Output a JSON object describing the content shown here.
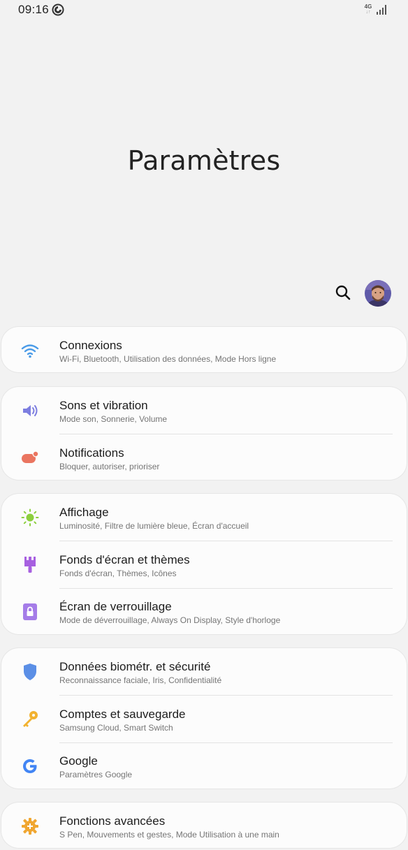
{
  "status_bar": {
    "time": "09:16",
    "network": "4G"
  },
  "header": {
    "title": "Paramètres"
  },
  "colors": {
    "wifi": "#4a9be8",
    "sound": "#7d7ee0",
    "notifications": "#ea7560",
    "display": "#8ccf3e",
    "wallpaper": "#a760e0",
    "lock": "#a57ce8",
    "biometrics": "#5b8fe6",
    "accounts": "#f2b230",
    "google": "#4285f4",
    "advanced": "#f0a630"
  },
  "groups": [
    {
      "items": [
        {
          "icon": "wifi-icon",
          "title": "Connexions",
          "subtitle": "Wi-Fi, Bluetooth, Utilisation des données, Mode Hors ligne"
        }
      ]
    },
    {
      "items": [
        {
          "icon": "speaker-icon",
          "title": "Sons et vibration",
          "subtitle": "Mode son, Sonnerie, Volume"
        },
        {
          "icon": "notification-icon",
          "title": "Notifications",
          "subtitle": "Bloquer, autoriser, prioriser"
        }
      ]
    },
    {
      "items": [
        {
          "icon": "brightness-icon",
          "title": "Affichage",
          "subtitle": "Luminosité, Filtre de lumière bleue, Écran d'accueil"
        },
        {
          "icon": "paintbrush-icon",
          "title": "Fonds d'écran et thèmes",
          "subtitle": "Fonds d'écran, Thèmes, Icônes"
        },
        {
          "icon": "lock-icon",
          "title": "Écran de verrouillage",
          "subtitle": "Mode de déverrouillage, Always On Display, Style d'horloge"
        }
      ]
    },
    {
      "items": [
        {
          "icon": "shield-icon",
          "title": "Données biométr. et sécurité",
          "subtitle": "Reconnaissance faciale, Iris, Confidentialité"
        },
        {
          "icon": "key-icon",
          "title": "Comptes et sauvegarde",
          "subtitle": "Samsung Cloud, Smart Switch"
        },
        {
          "icon": "google-icon",
          "title": "Google",
          "subtitle": "Paramètres Google"
        }
      ]
    },
    {
      "items": [
        {
          "icon": "gear-plus-icon",
          "title": "Fonctions avancées",
          "subtitle": "S Pen, Mouvements et gestes, Mode Utilisation à une main"
        }
      ]
    }
  ]
}
